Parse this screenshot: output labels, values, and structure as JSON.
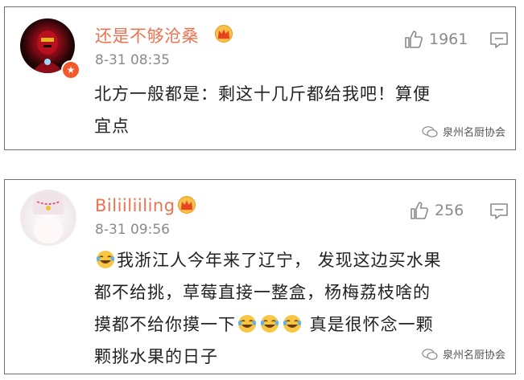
{
  "comments": [
    {
      "username": "还是不够沧桑",
      "timestamp": "8-31 08:35",
      "like_count": "1961",
      "body_lines": [
        "北方一般都是：剩这十几斤都给我吧！算便",
        "宜点"
      ],
      "watermark": "泉州名厨协会",
      "avatar": "iron-man-avatar",
      "badge": "vip-star-badge"
    },
    {
      "username": "Biliiliiling",
      "timestamp": "8-31 09:56",
      "like_count": "256",
      "body": {
        "line1_text": "我浙江人今年来了辽宁， 发现这边买水果",
        "line2": "都不给挑，草莓直接一整盒，杨梅荔枝啥的",
        "line3_text": "摸都不给你摸一下",
        "line3_tail": " 真是很怀念一颗",
        "line4": "颗挑水果的日子"
      },
      "watermark": "泉州名厨协会",
      "avatar": "girl-cartoon-avatar"
    }
  ],
  "colors": {
    "username": "#eb7350",
    "meta": "#8a8a8a",
    "body": "#222222",
    "border": "#6f6f6f",
    "crown": "#f5a623"
  }
}
